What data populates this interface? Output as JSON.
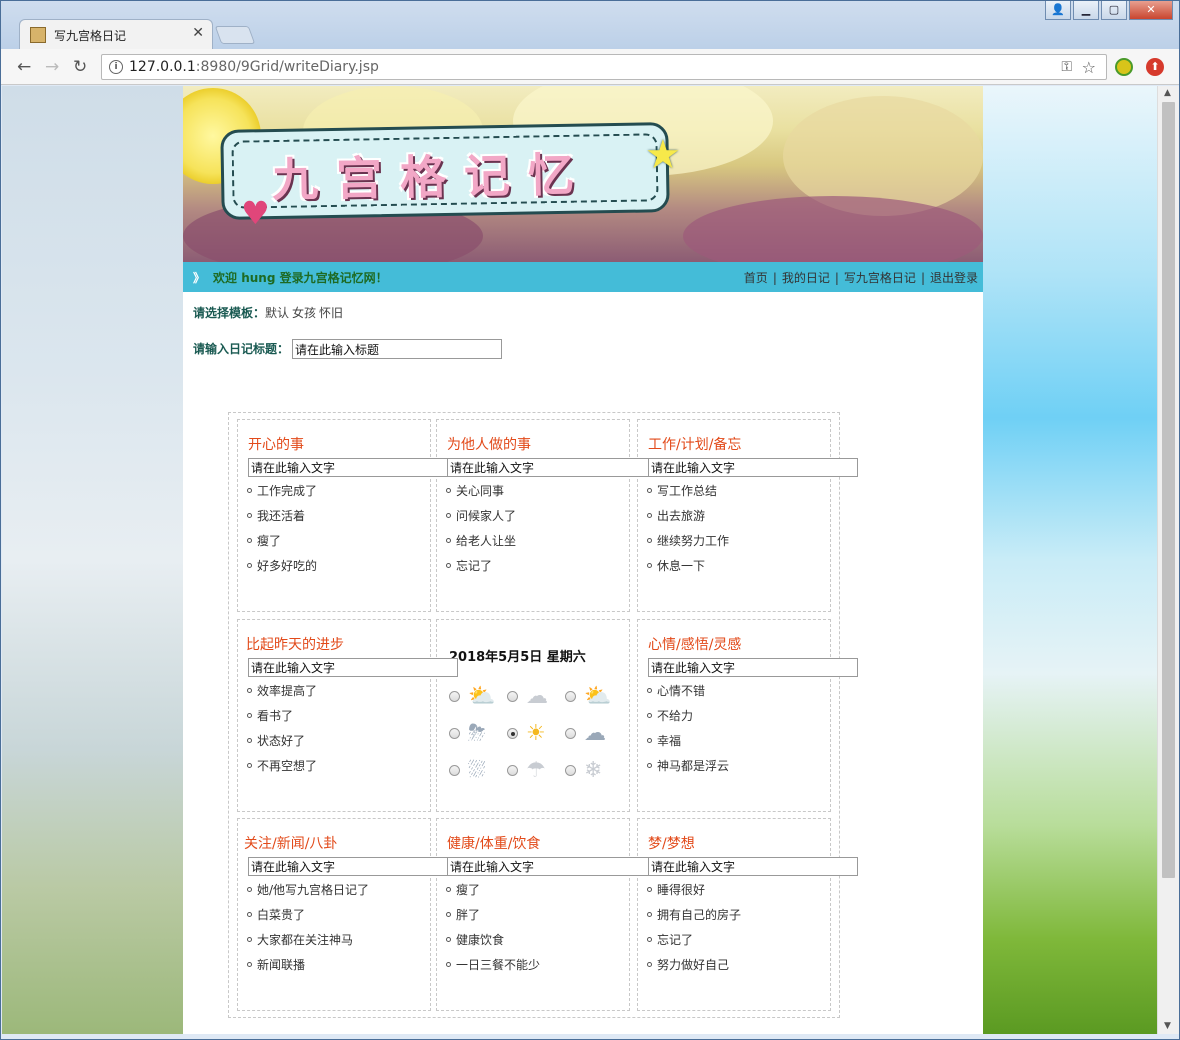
{
  "browser": {
    "tab_title": "写九宫格日记",
    "url_host": "127.0.0.1",
    "url_path": ":8980/9Grid/writeDiary.jsp"
  },
  "banner": {
    "logo_text": "九宫格记忆"
  },
  "navbar": {
    "arrow": "》",
    "welcome": "欢迎 hung 登录九宫格记忆网！",
    "links": [
      "首页",
      "我的日记",
      "写九宫格日记",
      "退出登录"
    ]
  },
  "form": {
    "template_label": "请选择模板：",
    "templates": [
      "默认",
      "女孩",
      "怀旧"
    ],
    "title_label": "请输入日记标题：",
    "title_value": "请在此输入标题"
  },
  "grid": {
    "input_value": "请在此输入文字",
    "cells": [
      {
        "title": "开心的事",
        "options": [
          "工作完成了",
          "我还活着",
          "瘦了",
          "好多好吃的"
        ]
      },
      {
        "title": "为他人做的事",
        "options": [
          "关心同事",
          "问候家人了",
          "给老人让坐",
          "忘记了"
        ]
      },
      {
        "title": "工作/计划/备忘",
        "options": [
          "写工作总结",
          "出去旅游",
          "继续努力工作",
          "休息一下"
        ]
      },
      {
        "title": "比起昨天的进步",
        "options": [
          "效率提高了",
          "看书了",
          "状态好了",
          "不再空想了"
        ]
      },
      {
        "title": "",
        "options": []
      },
      {
        "title": "心情/感悟/灵感",
        "options": [
          "心情不错",
          "不给力",
          "幸福",
          "神马都是浮云"
        ]
      },
      {
        "title": "关注/新闻/八卦",
        "options": [
          "她/他写九宫格日记了",
          "白菜贵了",
          "大家都在关注神马",
          "新闻联播"
        ]
      },
      {
        "title": "健康/体重/饮食",
        "options": [
          "瘦了",
          "胖了",
          "健康饮食",
          "一日三餐不能少"
        ]
      },
      {
        "title": "梦/梦想",
        "options": [
          "睡得很好",
          "拥有自己的房子",
          "忘记了",
          "努力做好自己"
        ]
      }
    ],
    "center": {
      "date": "2018年5月5日 星期六",
      "selected_weather_index": 4,
      "weather_icons": [
        "partly-sunny-icon",
        "cloudy-icon",
        "sun-cloud-icon",
        "thunder-rain-icon",
        "sunny-icon",
        "rain-cloud-icon",
        "heavy-rain-icon",
        "snow-rain-icon",
        "snow-icon"
      ]
    }
  },
  "colors": {
    "navbar_bg": "#44bcd8",
    "welcome_text": "#1e6a23",
    "cell_title": "#e24a1a",
    "label": "#1a5a52"
  }
}
